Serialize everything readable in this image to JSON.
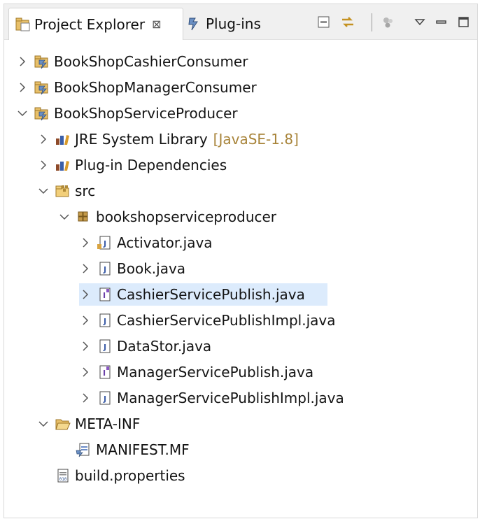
{
  "tabs": [
    {
      "label": "Project Explorer",
      "close": "⊠",
      "active": true
    },
    {
      "label": "Plug-ins",
      "active": false
    }
  ],
  "toolbar": {
    "icons": [
      "collapse-all-icon",
      "link-with-editor-icon",
      "filters-icon",
      "view-menu-icon",
      "minimize-icon",
      "maximize-icon"
    ]
  },
  "tree": [
    {
      "label": "BookShopCashierConsumer",
      "icon": "plugin-project-icon",
      "expanded": false
    },
    {
      "label": "BookShopManagerConsumer",
      "icon": "plugin-project-icon",
      "expanded": false
    },
    {
      "label": "BookShopServiceProducer",
      "icon": "plugin-project-icon",
      "expanded": true
    },
    {
      "label": "JRE System Library",
      "decoration": "[JavaSE-1.8]",
      "icon": "library-icon",
      "expanded": false
    },
    {
      "label": "Plug-in Dependencies",
      "icon": "library-icon",
      "expanded": false
    },
    {
      "label": "src",
      "icon": "source-folder-icon",
      "expanded": true
    },
    {
      "label": "bookshopserviceproducer",
      "icon": "package-icon",
      "expanded": true
    },
    {
      "label": "Activator.java",
      "icon": "java-file-icon",
      "expanded": false
    },
    {
      "label": "Book.java",
      "icon": "java-file-icon",
      "expanded": false
    },
    {
      "label": "CashierServicePublish.java",
      "icon": "interface-file-icon",
      "expanded": false,
      "selected": true
    },
    {
      "label": "CashierServicePublishImpl.java",
      "icon": "java-file-icon",
      "expanded": false
    },
    {
      "label": "DataStor.java",
      "icon": "java-file-icon",
      "expanded": false
    },
    {
      "label": "ManagerServicePublish.java",
      "icon": "interface-file-icon",
      "expanded": false
    },
    {
      "label": "ManagerServicePublishImpl.java",
      "icon": "java-file-icon",
      "expanded": false
    },
    {
      "label": "META-INF",
      "icon": "folder-icon",
      "expanded": true
    },
    {
      "label": "MANIFEST.MF",
      "icon": "manifest-file-icon"
    },
    {
      "label": "build.properties",
      "icon": "properties-file-icon"
    }
  ]
}
